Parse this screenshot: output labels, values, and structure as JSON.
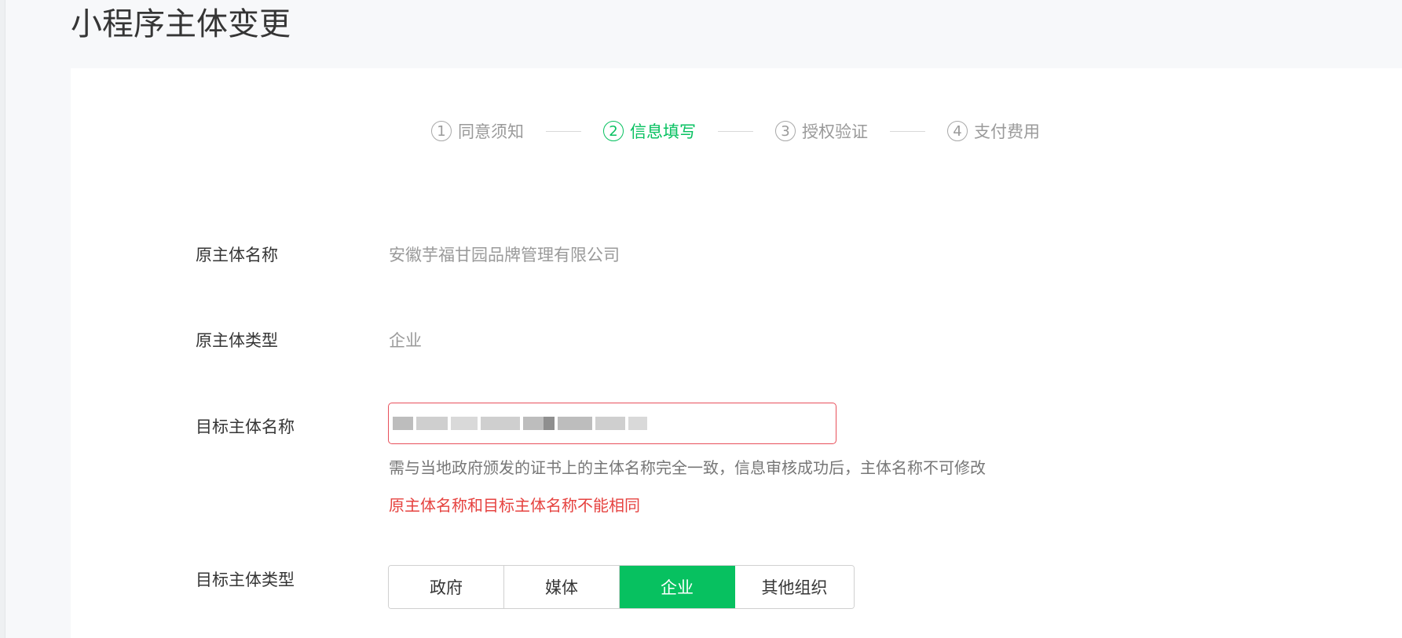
{
  "header": {
    "title": "小程序主体变更"
  },
  "steps": [
    {
      "num": "1",
      "label": "同意须知",
      "active": false
    },
    {
      "num": "2",
      "label": "信息填写",
      "active": true
    },
    {
      "num": "3",
      "label": "授权验证",
      "active": false
    },
    {
      "num": "4",
      "label": "支付费用",
      "active": false
    }
  ],
  "form": {
    "original_name": {
      "label": "原主体名称",
      "value": "安徽芋福甘园品牌管理有限公司"
    },
    "original_type": {
      "label": "原主体类型",
      "value": "企业"
    },
    "target_name": {
      "label": "目标主体名称",
      "value": "",
      "hint": "需与当地政府颁发的证书上的主体名称完全一致，信息审核成功后，主体名称不可修改",
      "error": "原主体名称和目标主体名称不能相同"
    },
    "target_type": {
      "label": "目标主体类型",
      "options": [
        "政府",
        "媒体",
        "企业",
        "其他组织"
      ],
      "selected": "企业"
    }
  },
  "colors": {
    "accent": "#07c160",
    "error": "#e64340",
    "text": "#353535",
    "muted": "#9a9a9a"
  }
}
